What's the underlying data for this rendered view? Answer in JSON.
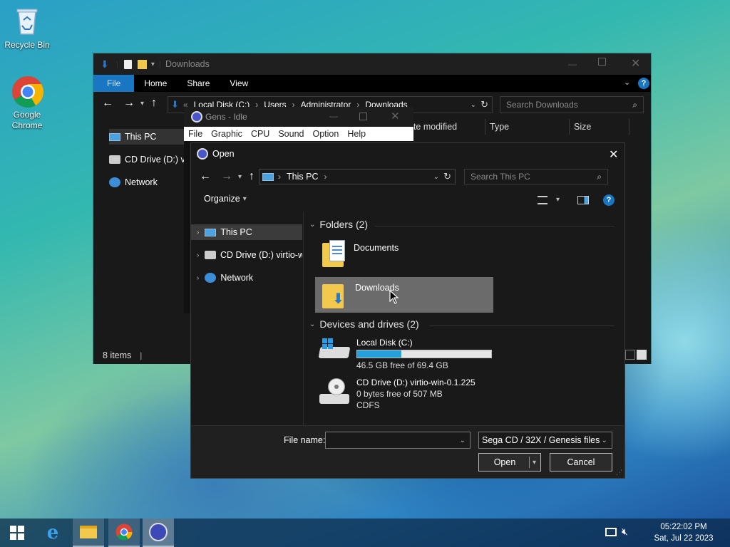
{
  "desktop": {
    "icons": [
      {
        "label": "Recycle Bin",
        "icon": "recycle-bin-icon"
      },
      {
        "label": "Google Chrome",
        "icon": "chrome-icon"
      }
    ]
  },
  "explorer": {
    "title": "Downloads",
    "ribbon_tabs": [
      "File",
      "Home",
      "Share",
      "View"
    ],
    "breadcrumb": [
      "Local Disk (C:)",
      "Users",
      "Administrator",
      "Downloads"
    ],
    "search_placeholder": "Search Downloads",
    "sidebar": [
      "This PC",
      "CD Drive (D:) vir",
      "Network"
    ],
    "columns": [
      "ate modified",
      "Type",
      "Size"
    ],
    "status": "8 items"
  },
  "gens": {
    "title": "Gens - Idle",
    "menu": [
      "File",
      "Graphic",
      "CPU",
      "Sound",
      "Option",
      "Help"
    ]
  },
  "open_dialog": {
    "title": "Open",
    "breadcrumb": "This PC",
    "search_placeholder": "Search This PC",
    "organize_label": "Organize",
    "tree": [
      "This PC",
      "CD Drive (D:) virtio-w",
      "Network"
    ],
    "folders_header": "Folders (2)",
    "folders": [
      "Documents",
      "Downloads"
    ],
    "devices_header": "Devices and drives (2)",
    "drives": [
      {
        "name": "Local Disk (C:)",
        "free": "46.5 GB free of 69.4 GB",
        "used_fraction": 0.33
      },
      {
        "name": "CD Drive (D:) virtio-win-0.1.225",
        "free": "0 bytes free of 507 MB",
        "fs": "CDFS"
      }
    ],
    "file_name_label": "File name:",
    "file_name_value": "",
    "file_type": "Sega CD / 32X / Genesis files",
    "open_button": "Open",
    "cancel_button": "Cancel"
  },
  "taskbar": {
    "time": "05:22:02 PM",
    "date": "Sat, Jul 22 2023"
  },
  "colors": {
    "accent": "#1976c2",
    "selection": "#6b6b6b",
    "drive_bar": "#26a0da"
  }
}
